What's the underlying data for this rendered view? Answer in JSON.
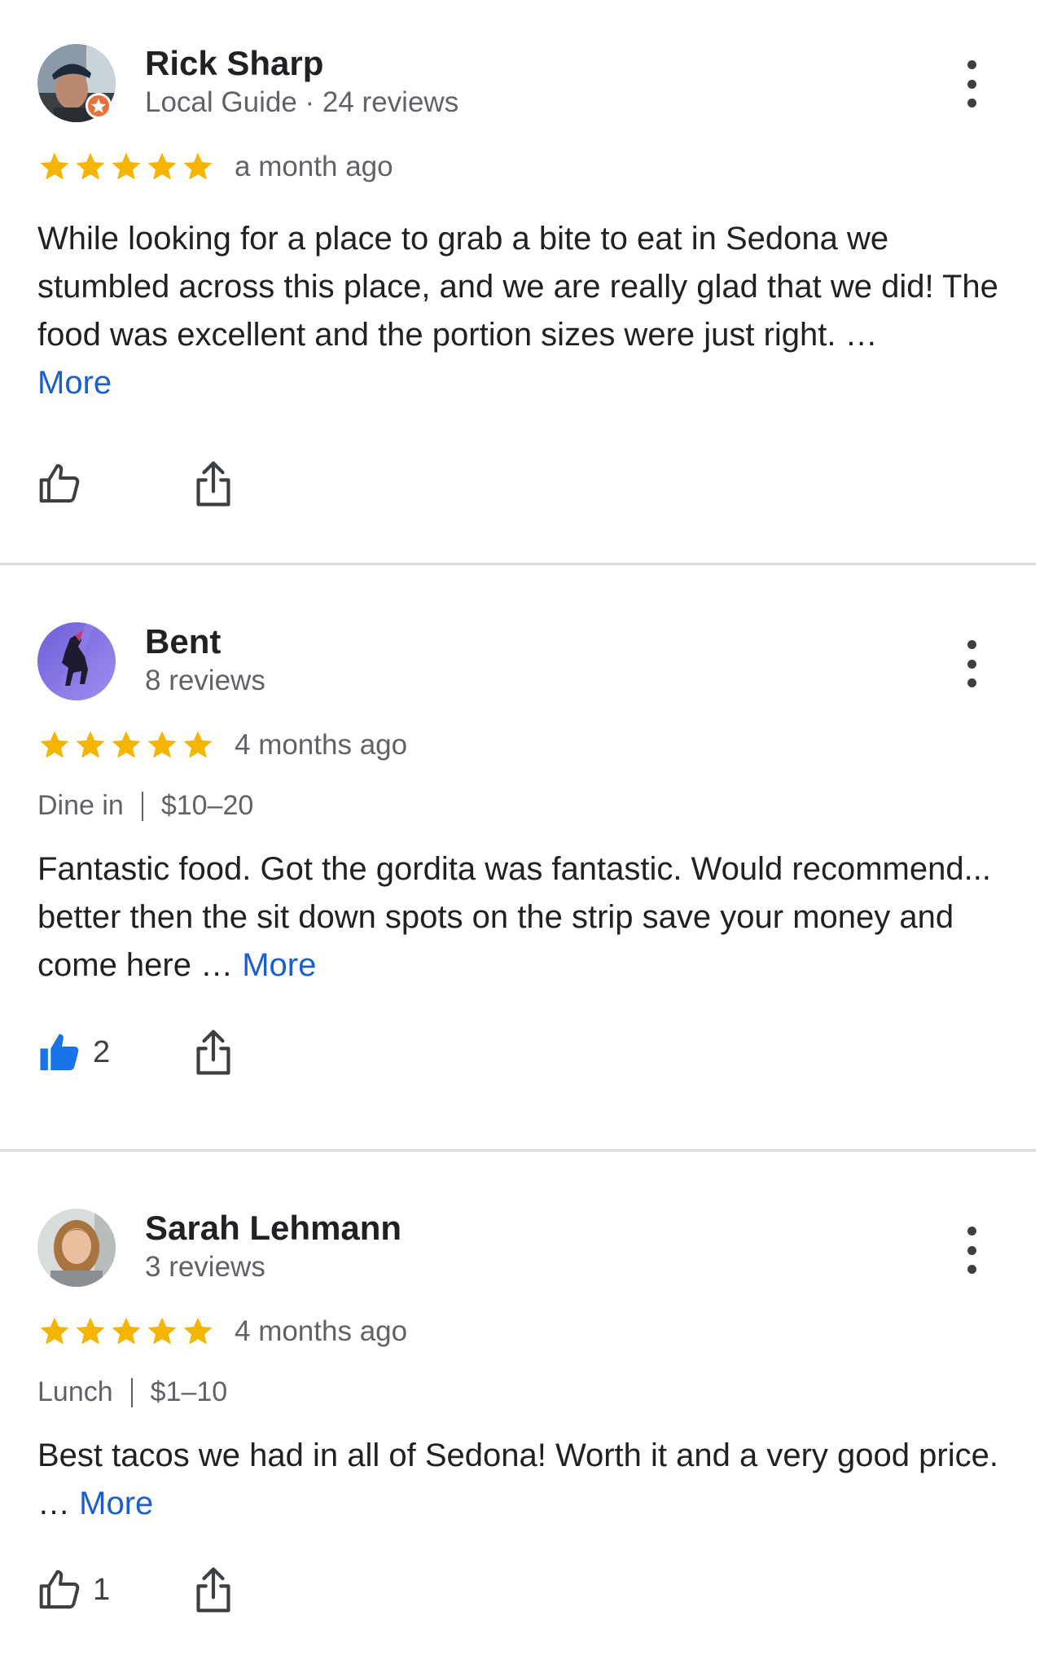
{
  "colors": {
    "star": "#f4b400",
    "link": "#1a5fd0",
    "like_active": "#1a73e8",
    "divider": "#dadce0"
  },
  "reviews": [
    {
      "author": "Rick Sharp",
      "meta": "Local Guide · 24 reviews",
      "rating": 5,
      "time": "a month ago",
      "text": "While looking for a place to grab a bite to eat in Sedona we stumbled across this place, and we are really glad that we did! The food was excellent and the portion sizes were just right. …",
      "more_label": "More",
      "likes": ""
    },
    {
      "author": "Bent",
      "meta": "8 reviews",
      "rating": 5,
      "time": "4 months ago",
      "attr_1": "Dine in",
      "attr_2": "$10–20",
      "text": "Fantastic food. Got the gordita was fantastic. Would recommend... better then the sit down spots on the strip save your money and come here …",
      "more_label": "More",
      "likes": "2"
    },
    {
      "author": "Sarah Lehmann",
      "meta": "3 reviews",
      "rating": 5,
      "time": "4 months ago",
      "attr_1": "Lunch",
      "attr_2": "$1–10",
      "text": "Best tacos we had in all of Sedona! Worth it and a very good price. …",
      "more_label": "More",
      "likes": "1"
    }
  ]
}
